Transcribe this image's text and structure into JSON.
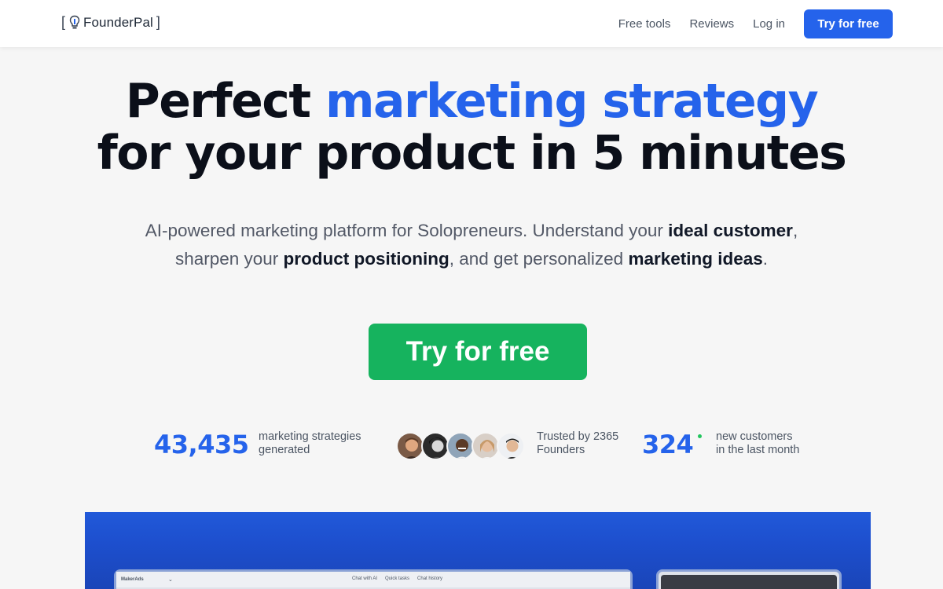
{
  "nav": {
    "logo_text": "FounderPal",
    "links": [
      "Free tools",
      "Reviews",
      "Log in"
    ],
    "cta": "Try for free"
  },
  "hero": {
    "headline_part1": "Perfect ",
    "headline_accent": "marketing strategy",
    "headline_line2": "for your product in 5 minutes",
    "sub_1": "AI-powered marketing platform for Solopreneurs. Understand your ",
    "sub_b1": "ideal customer",
    "sub_2": ",",
    "sub_3": "sharpen your ",
    "sub_b2": "product positioning",
    "sub_4": ", and get personalized ",
    "sub_b3": "marketing ideas",
    "sub_5": ".",
    "cta": "Try for free"
  },
  "stats": {
    "strategies_count": "43,435",
    "strategies_label_1": "marketing strategies",
    "strategies_label_2": "generated",
    "trusted_label_1": "Trusted by 2365",
    "trusted_label_2": "Founders",
    "customers_count": "324",
    "customers_label_1": "new customers",
    "customers_label_2": "in the last month"
  },
  "preview": {
    "app_brand": "MakerAds",
    "tabs": [
      "Chat with AI",
      "Quick tasks",
      "Chat history"
    ]
  },
  "colors": {
    "accent": "#2563eb",
    "cta_green": "#16b35e",
    "live_dot": "#22c55e"
  }
}
